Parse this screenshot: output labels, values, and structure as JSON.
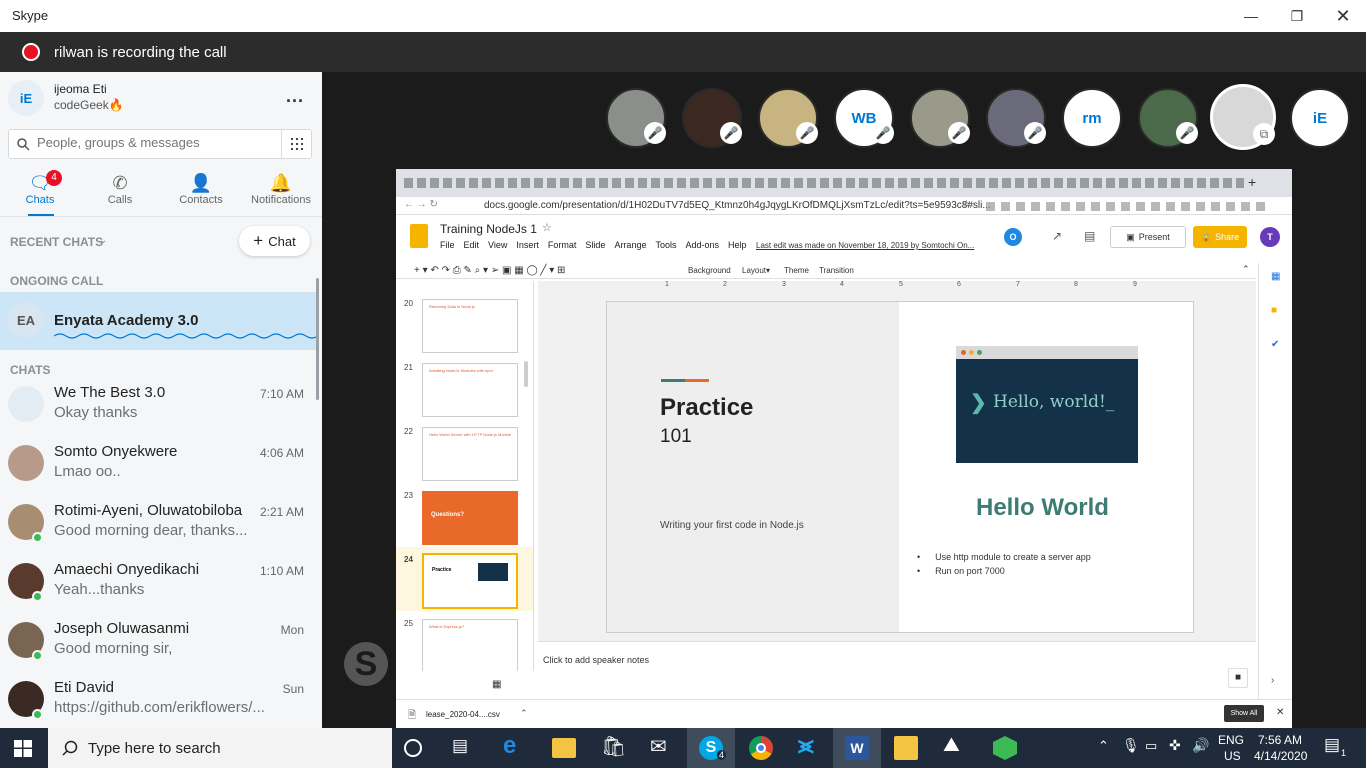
{
  "window": {
    "title": "Skype"
  },
  "recording": {
    "text": "rilwan is recording the call"
  },
  "profile": {
    "initials": "iE",
    "name": "ijeoma Eti",
    "status": "codeGeek🔥",
    "menu": "..."
  },
  "search": {
    "placeholder": "People, groups & messages"
  },
  "nav": [
    {
      "label": "Chats",
      "badge": "4",
      "icon": "chat-icon"
    },
    {
      "label": "Calls",
      "icon": "phone-icon"
    },
    {
      "label": "Contacts",
      "icon": "contacts-icon"
    },
    {
      "label": "Notifications",
      "icon": "bell-icon"
    }
  ],
  "recent_chats": {
    "label": "RECENT CHATS",
    "new_chat": "Chat"
  },
  "ongoing": {
    "label": "ONGOING CALL",
    "initials": "EA",
    "name": "Enyata Academy 3.0"
  },
  "chats_label": "CHATS",
  "chats": [
    {
      "name": "We The Best 3.0",
      "time": "7:10 AM",
      "preview": "Okay thanks",
      "color": "#e3ecf3"
    },
    {
      "name": "Somto Onyekwere",
      "time": "4:06 AM",
      "preview": "Lmao oo..",
      "color": "#b79a8a"
    },
    {
      "name": "Rotimi-Ayeni, Oluwatobiloba",
      "time": "2:21 AM",
      "preview": " Good morning dear, thanks...",
      "color": "#a78d72"
    },
    {
      "name": "Amaechi Onyedikachi",
      "time": "1:10 AM",
      "preview": "Yeah...thanks",
      "color": "#5a3a2c"
    },
    {
      "name": "Joseph Oluwasanmi",
      "time": "Mon",
      "preview": "Good morning sir,",
      "color": "#7a6552"
    },
    {
      "name": "Eti David",
      "time": "Sun",
      "preview": "https://github.com/erikflowers/...",
      "color": "#3b2a24"
    }
  ],
  "participants": [
    {
      "initials": "",
      "color": "#8a8f8a"
    },
    {
      "initials": "",
      "color": "#3b2820"
    },
    {
      "initials": "",
      "color": "#c8b480"
    },
    {
      "initials": "WB",
      "color": "#ffffff"
    },
    {
      "initials": "",
      "color": "#9a9a8a"
    },
    {
      "initials": "",
      "color": "#6a6a7a"
    },
    {
      "initials": "rm",
      "color": "#ffffff"
    },
    {
      "initials": "",
      "color": "#4a6a4a"
    },
    {
      "initials": "",
      "color": "#d8d8d8"
    },
    {
      "initials": "iE",
      "color": "#ffffff"
    }
  ],
  "browser": {
    "url": "docs.google.com/presentation/d/1H02DuTV7d5EQ_Ktmnz0h4gJqygLKrOfDMQLjXsmTzLc/edit?ts=5e9593c8#sli...",
    "doc_title": "Training NodeJs 1",
    "menus": [
      "File",
      "Edit",
      "View",
      "Insert",
      "Format",
      "Slide",
      "Arrange",
      "Tools",
      "Add-ons",
      "Help"
    ],
    "last_edit": "Last edit was made on November 18, 2019 by Somtochi On...",
    "present": "Present",
    "share": "Share",
    "user_initial": "T",
    "collab_initial": "O",
    "toolbar": [
      "Background",
      "Layout▾",
      "Theme",
      "Transition"
    ],
    "ruler": [
      "1",
      "2",
      "3",
      "4",
      "5",
      "6",
      "7",
      "8",
      "9"
    ],
    "slides": [
      {
        "num": "20",
        "title": "Returning Data in Node.js"
      },
      {
        "num": "21",
        "title": "Installing NodeJs Modules with npm"
      },
      {
        "num": "22",
        "title": "Hello World Server with HTTP Node.js Module"
      },
      {
        "num": "23",
        "title": "Questions?"
      },
      {
        "num": "24",
        "title": "Practice"
      },
      {
        "num": "25",
        "title": "What is Express.js?"
      }
    ],
    "slide": {
      "title": "Practice",
      "subtitle": "101",
      "caption": "Writing your first code in Node.js",
      "code_text": "Hello, world!_",
      "heading": "Hello World",
      "bullets": [
        "Use http module to create a server app",
        "Run on port 7000"
      ]
    },
    "notes": "Click to add speaker notes",
    "download": "lease_2020-04....csv",
    "show_all": "Show All"
  },
  "taskbar": {
    "search_placeholder": "Type here to search",
    "lang1": "ENG",
    "lang2": "US",
    "time": "7:56 AM",
    "date": "4/14/2020",
    "skype_badge": "4",
    "notif_count": "1"
  }
}
